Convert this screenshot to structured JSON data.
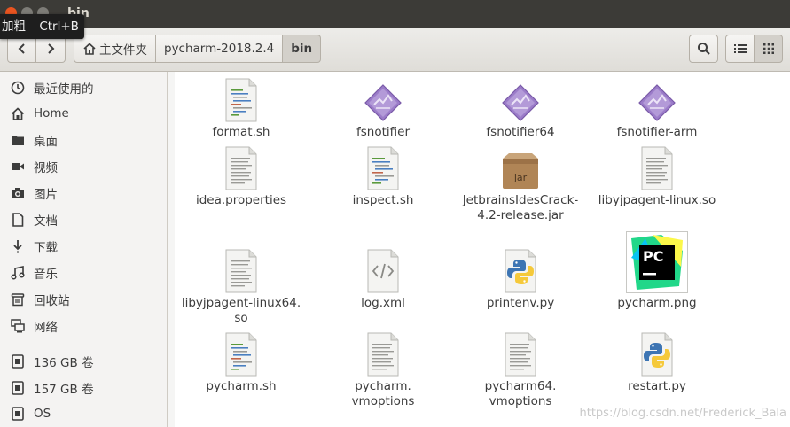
{
  "window": {
    "title": "bin"
  },
  "tooltip": {
    "text": "加粗 – Ctrl+B"
  },
  "breadcrumbs": [
    {
      "label": "主文件夹",
      "icon": "home-icon"
    },
    {
      "label": "pycharm-2018.2.4"
    },
    {
      "label": "bin"
    }
  ],
  "sidebar": {
    "items": [
      {
        "label": "最近使用的",
        "icon": "recent-icon"
      },
      {
        "label": "Home",
        "icon": "home-icon"
      },
      {
        "label": "桌面",
        "icon": "desktop-folder-icon"
      },
      {
        "label": "视频",
        "icon": "video-icon"
      },
      {
        "label": "图片",
        "icon": "camera-icon"
      },
      {
        "label": "文档",
        "icon": "document-icon"
      },
      {
        "label": "下载",
        "icon": "download-icon"
      },
      {
        "label": "音乐",
        "icon": "music-icon"
      },
      {
        "label": "回收站",
        "icon": "trash-icon"
      },
      {
        "label": "网络",
        "icon": "network-icon"
      },
      {
        "label": "136 GB 卷",
        "icon": "drive-icon"
      },
      {
        "label": "157 GB 卷",
        "icon": "drive-icon"
      },
      {
        "label": "OS",
        "icon": "drive-icon"
      }
    ]
  },
  "files": [
    {
      "name": "format.sh",
      "icon": "script-icon"
    },
    {
      "name": "fsnotifier",
      "icon": "executable-icon"
    },
    {
      "name": "fsnotifier64",
      "icon": "executable-icon"
    },
    {
      "name": "fsnotifier-arm",
      "icon": "executable-icon"
    },
    {
      "name": "idea.properties",
      "icon": "text-file-icon"
    },
    {
      "name": "inspect.sh",
      "icon": "script-icon"
    },
    {
      "name": "JetbrainsIdesCrack-\n4.2-release.jar",
      "icon": "jar-icon",
      "icon_text": "jar"
    },
    {
      "name": "libyjpagent-linux.so",
      "icon": "text-file-icon"
    },
    {
      "name": "libyjpagent-linux64.\nso",
      "icon": "text-file-icon"
    },
    {
      "name": "log.xml",
      "icon": "xml-icon"
    },
    {
      "name": "printenv.py",
      "icon": "python-icon"
    },
    {
      "name": "pycharm.png",
      "icon": "pycharm-logo-icon",
      "icon_text": "PC"
    },
    {
      "name": "pycharm.sh",
      "icon": "script-icon"
    },
    {
      "name": "pycharm.\nvmoptions",
      "icon": "text-file-icon"
    },
    {
      "name": "pycharm64.\nvmoptions",
      "icon": "text-file-icon"
    },
    {
      "name": "restart.py",
      "icon": "python-icon"
    }
  ],
  "watermark": "https://blog.csdn.net/Frederick_Bala",
  "colors": {
    "accent": "#e95420",
    "titlebar": "#3c3b37",
    "exec_icon": "#8f6fbf",
    "jar_box": "#b08050"
  }
}
